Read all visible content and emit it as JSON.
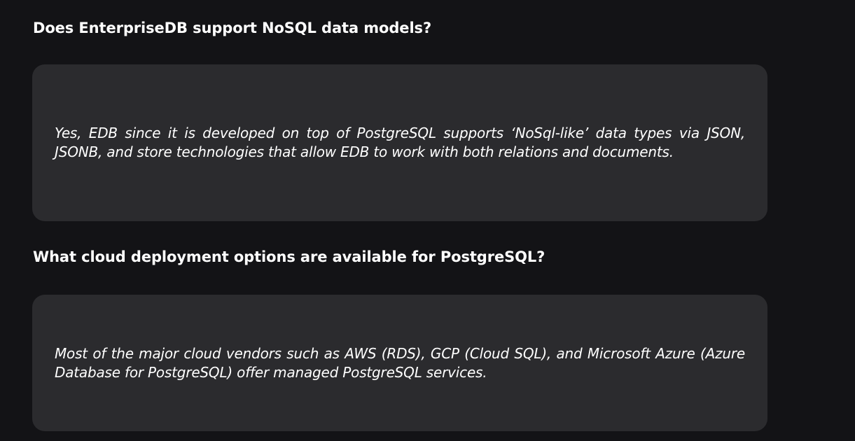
{
  "faq": [
    {
      "question": "Does EnterpriseDB support NoSQL data models?",
      "answer": "Yes, EDB since it is developed on top of PostgreSQL supports ‘NoSql-like’ data types via JSON, JSONB, and store technologies that allow EDB to work with both relations and documents."
    },
    {
      "question": "What cloud deployment options are available for PostgreSQL?",
      "answer": "Most of the major cloud vendors such as AWS (RDS), GCP (Cloud SQL), and Microsoft Azure (Azure Database for PostgreSQL) offer managed PostgreSQL services."
    }
  ],
  "colors": {
    "background": "#131316",
    "card": "#2b2b2e",
    "text": "#ffffff"
  }
}
